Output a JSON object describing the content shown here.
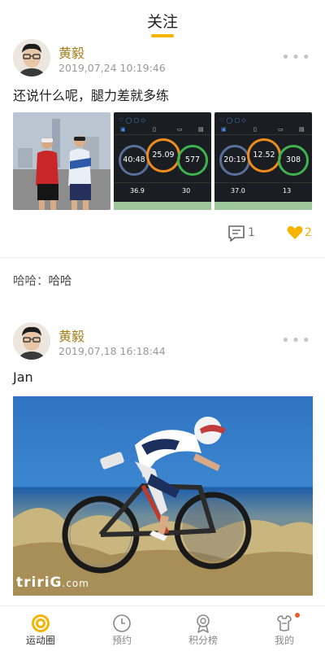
{
  "header": {
    "title": "关注"
  },
  "posts": [
    {
      "author": "黄毅",
      "time": "2019,07,24 10:19:46",
      "more": "•••",
      "text": "还说什么呢，腿力差就多练",
      "watch_screens": [
        {
          "rings": [
            "40:48",
            "25.09",
            "577"
          ],
          "stats": [
            "36.9",
            "30"
          ]
        },
        {
          "rings": [
            "20:19",
            "12.52",
            "308"
          ],
          "stats": [
            "37.0",
            "13"
          ]
        }
      ],
      "comment_count": "1",
      "like_count": "2"
    },
    {
      "author": "黄毅",
      "time": "2019,07,18 16:18:44",
      "more": "•••",
      "text": "Jan",
      "photo_brand": "tririG",
      "photo_brand_suffix": ".com"
    }
  ],
  "comment": {
    "author": "哈哈：",
    "text": "哈哈"
  },
  "tabbar": {
    "items": [
      {
        "label": "运动圈",
        "icon": "target-icon",
        "active": true
      },
      {
        "label": "预约",
        "icon": "clock-icon"
      },
      {
        "label": "积分榜",
        "icon": "medal-icon"
      },
      {
        "label": "我的",
        "icon": "tools-icon",
        "badge": true
      }
    ]
  },
  "colors": {
    "accent": "#f5b400",
    "author": "#a57e1a",
    "badge": "#ef5a2a"
  }
}
